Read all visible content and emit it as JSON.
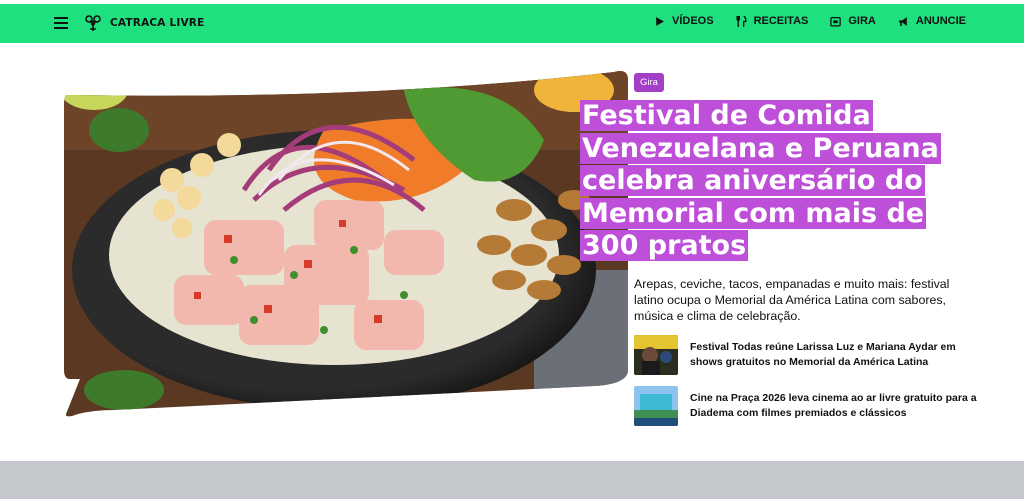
{
  "nav": {
    "logo_text": "CATRACA LIVRE",
    "links": [
      {
        "label": "VÍDEOS",
        "icon": "play-icon"
      },
      {
        "label": "RECEITAS",
        "icon": "cutlery-icon"
      },
      {
        "label": "GIRA",
        "icon": "ticket-icon"
      },
      {
        "label": "ANUNCIE",
        "icon": "megaphone-icon"
      }
    ]
  },
  "hero": {
    "image_icon": "ceviche-bowl-photo",
    "tag": "Gira",
    "headline": "Festival de Comida Venezuelana e Peruana celebra aniversário do Memorial com mais de 300 pratos",
    "summary": "Arepas, ceviche, tacos, empanadas e muito mais: festival latino ocupa o Memorial da América Latina com sabores, música e clima de celebração."
  },
  "related": [
    {
      "title": "Festival Todas reúne Larissa Luz e Mariana Aydar em shows gratuitos no Memorial da América Latina",
      "thumb_icon": "concert-photo"
    },
    {
      "title": "Cine na Praça 2026 leva cinema ao ar livre gratuito para a Diadema com filmes premiados e clássicos",
      "thumb_icon": "outdoor-cinema-photo"
    }
  ],
  "colors": {
    "nav_bg": "#1ee07f",
    "tag_bg": "#a33ec6",
    "headline_highlight": "#bd4fd8",
    "footer_bg": "#c4c7cc"
  }
}
